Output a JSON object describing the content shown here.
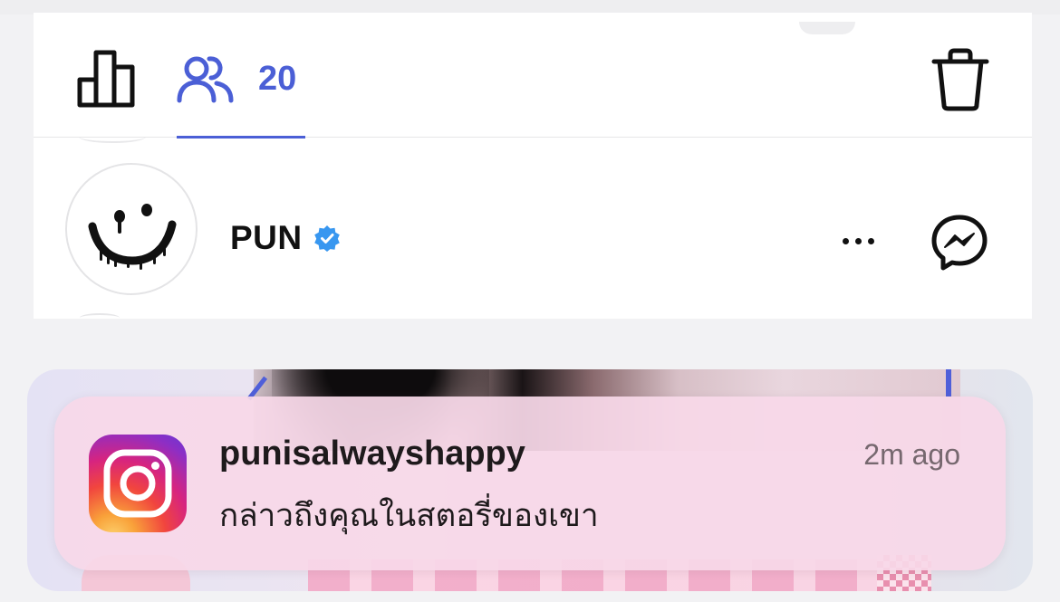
{
  "viewers_sheet": {
    "toolbar": {
      "stats_icon": "bar-chart-icon",
      "viewers_icon": "people-icon",
      "viewer_count": "20",
      "delete_icon": "trash-icon",
      "accent_color": "#4b5fd6"
    },
    "viewer": {
      "avatar_icon": "dripping-smiley-icon",
      "username": "PUN",
      "verified": true,
      "verified_color": "#3897f0",
      "more_icon": "more-dots-icon",
      "message_icon": "messenger-icon"
    }
  },
  "notification": {
    "app_icon": "instagram-icon",
    "title": "punisalwayshappy",
    "time": "2m ago",
    "body": "กล่าวถึงคุณในสตอรี่ของเขา"
  }
}
